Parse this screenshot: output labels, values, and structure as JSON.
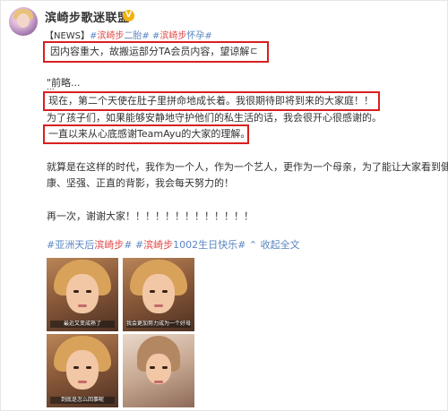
{
  "post": {
    "user_name": "滨崎步歌迷联盟",
    "verified_glyph": "V",
    "news_tag": "【NEWS】",
    "topic1_prefix": "#",
    "topic1_hl": "滨崎步",
    "topic1_rest": "二胎#",
    "topic2_prefix": " #",
    "topic2_hl": "滨崎步",
    "topic2_rest": "怀孕#",
    "box1_text": "因内容重大，故搬运部分TA会员内容，望谅解ㄷ",
    "line_quote": "\"前略...",
    "line_ellipsis": "...",
    "box2_text": "现在，第二个天使在肚子里拼命地成长着。我很期待即将到来的大家庭！！",
    "line_children": "为了孩子们，如果能够安静地守护他们的私生活的话，我会很开心很感谢的。",
    "box3_text": "一直以来从心底感谢TeamAyu的大家的理解。",
    "para1_line1": "就算是在这样的时代，我作为一个人，作为一个艺人，更作为一个母亲，为了能让大家看到健",
    "para1_line2": "康、坚强、正直的背影，我会每天努力的！",
    "para2": "再一次，谢谢大家！！！！！！！！！！！！！",
    "tag1_prefix": "#亚洲天后",
    "tag1_hl": "滨崎步",
    "tag1_suffix": "#",
    "tag2_prefix": " #",
    "tag2_hl": "滨崎步",
    "tag2_suffix": "1002生日快乐#",
    "tag_sep": " ",
    "collect_text": "收起全文",
    "collect_glyph": "⌃"
  },
  "photos": [
    {
      "caption": "最近又变成熟了"
    },
    {
      "caption": "我会更加努力成为一个好母亲"
    },
    {
      "caption": "到底是怎么回事呢"
    },
    {
      "caption": ""
    }
  ],
  "colors": {
    "highlight_box": "#d82020",
    "topic_blue": "#5b86c2",
    "name_red": "#e14b4b",
    "verified_gold": "#f3b20e"
  }
}
